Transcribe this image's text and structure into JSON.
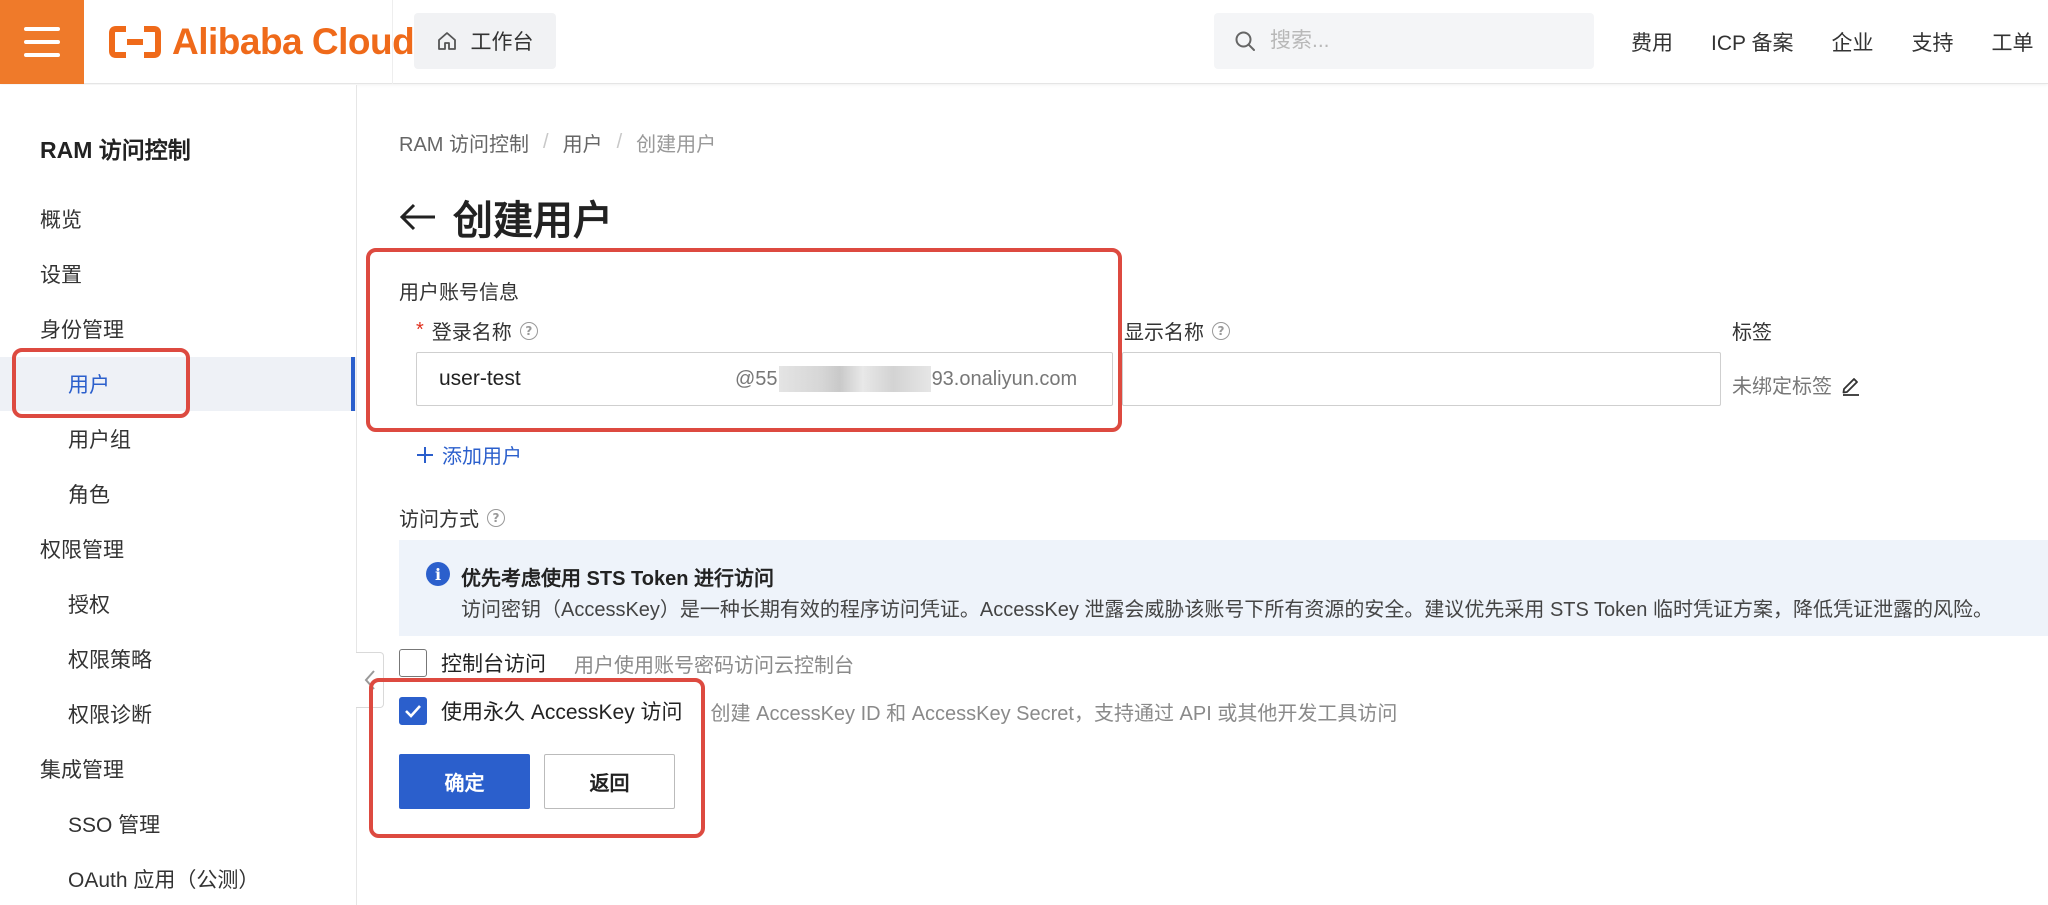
{
  "brand": {
    "name": "Alibaba Cloud",
    "color": "#ef6a1a"
  },
  "topbar": {
    "workbench": "工作台",
    "search_placeholder": "搜索...",
    "nav": [
      "费用",
      "ICP 备案",
      "企业",
      "支持",
      "工单"
    ]
  },
  "sidebar": {
    "title": "RAM 访问控制",
    "items": [
      {
        "label": "概览",
        "level": 1
      },
      {
        "label": "设置",
        "level": 1
      },
      {
        "label": "身份管理",
        "level": 1
      },
      {
        "label": "用户",
        "level": 2,
        "active": true
      },
      {
        "label": "用户组",
        "level": 2
      },
      {
        "label": "角色",
        "level": 2
      },
      {
        "label": "权限管理",
        "level": 1
      },
      {
        "label": "授权",
        "level": 2
      },
      {
        "label": "权限策略",
        "level": 2
      },
      {
        "label": "权限诊断",
        "level": 2
      },
      {
        "label": "集成管理",
        "level": 1
      },
      {
        "label": "SSO 管理",
        "level": 2
      },
      {
        "label": "OAuth 应用（公测）",
        "level": 2
      }
    ]
  },
  "breadcrumb": [
    "RAM 访问控制",
    "用户",
    "创建用户"
  ],
  "page": {
    "title": "创建用户"
  },
  "form": {
    "section_title": "用户账号信息",
    "login_name": {
      "required_mark": "*",
      "label": "登录名称",
      "value": "user-test",
      "suffix_prefix": "@55",
      "suffix_end": "93.onaliyun.com"
    },
    "display_name": {
      "label": "显示名称",
      "value": ""
    },
    "tags": {
      "label": "标签",
      "value": "未绑定标签"
    },
    "add_user": "添加用户"
  },
  "access": {
    "label": "访问方式",
    "banner": {
      "title": "优先考虑使用 STS Token 进行访问",
      "desc": "访问密钥（AccessKey）是一种长期有效的程序访问凭证。AccessKey 泄露会威胁该账号下所有资源的安全。建议优先采用 STS Token 临时凭证方案，降低凭证泄露的风险。"
    },
    "options": [
      {
        "label": "控制台访问",
        "desc": "用户使用账号密码访问云控制台",
        "checked": false
      },
      {
        "label": "使用永久 AccessKey 访问",
        "desc": "创建 AccessKey ID 和 AccessKey Secret，支持通过 API 或其他开发工具访问",
        "checked": true
      }
    ]
  },
  "buttons": {
    "confirm": "确定",
    "back": "返回"
  },
  "colors": {
    "accent": "#2b5fcc",
    "menu": "#ef7a2a",
    "annotation": "#dd4a40"
  }
}
